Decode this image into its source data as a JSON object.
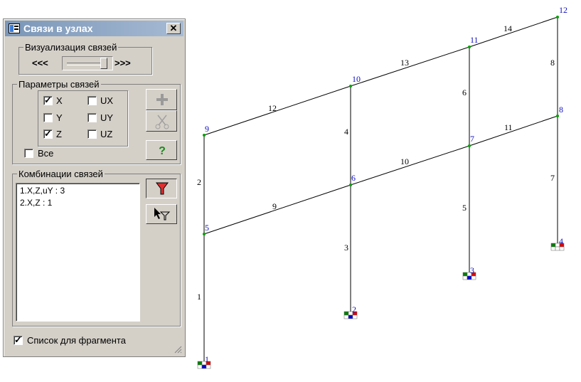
{
  "dialog": {
    "title": "Связи в узлах",
    "close_label": "✕",
    "visualization": {
      "legend": "Визуализация связей",
      "left_label": "<<<",
      "right_label": ">>>"
    },
    "params": {
      "legend": "Параметры связей",
      "checks": [
        {
          "label": "X",
          "checked": true
        },
        {
          "label": "UX",
          "checked": false
        },
        {
          "label": "Y",
          "checked": false
        },
        {
          "label": "UY",
          "checked": false
        },
        {
          "label": "Z",
          "checked": true
        },
        {
          "label": "UZ",
          "checked": false
        }
      ],
      "all_label": "Все",
      "all_checked": false
    },
    "combos": {
      "legend": "Комбинации связей",
      "items": [
        "1.X,Z,uY  :  3",
        "2.X,Z  :  1"
      ]
    },
    "fragment_label": "Список для фрагмента",
    "fragment_checked": true
  },
  "scheme": {
    "node_labels": [
      "1",
      "2",
      "3",
      "4",
      "5",
      "6",
      "7",
      "8",
      "9",
      "10",
      "11",
      "12"
    ],
    "element_labels": [
      "1",
      "2",
      "3",
      "4",
      "5",
      "6",
      "7",
      "8",
      "9",
      "10",
      "11",
      "12",
      "13",
      "14"
    ],
    "colors": {
      "node_label": "#1010c0",
      "element_label": "#000000",
      "node_dot": "#00a000",
      "support_red": "#e00000",
      "support_green": "#008000",
      "support_blue": "#0000d0"
    }
  }
}
